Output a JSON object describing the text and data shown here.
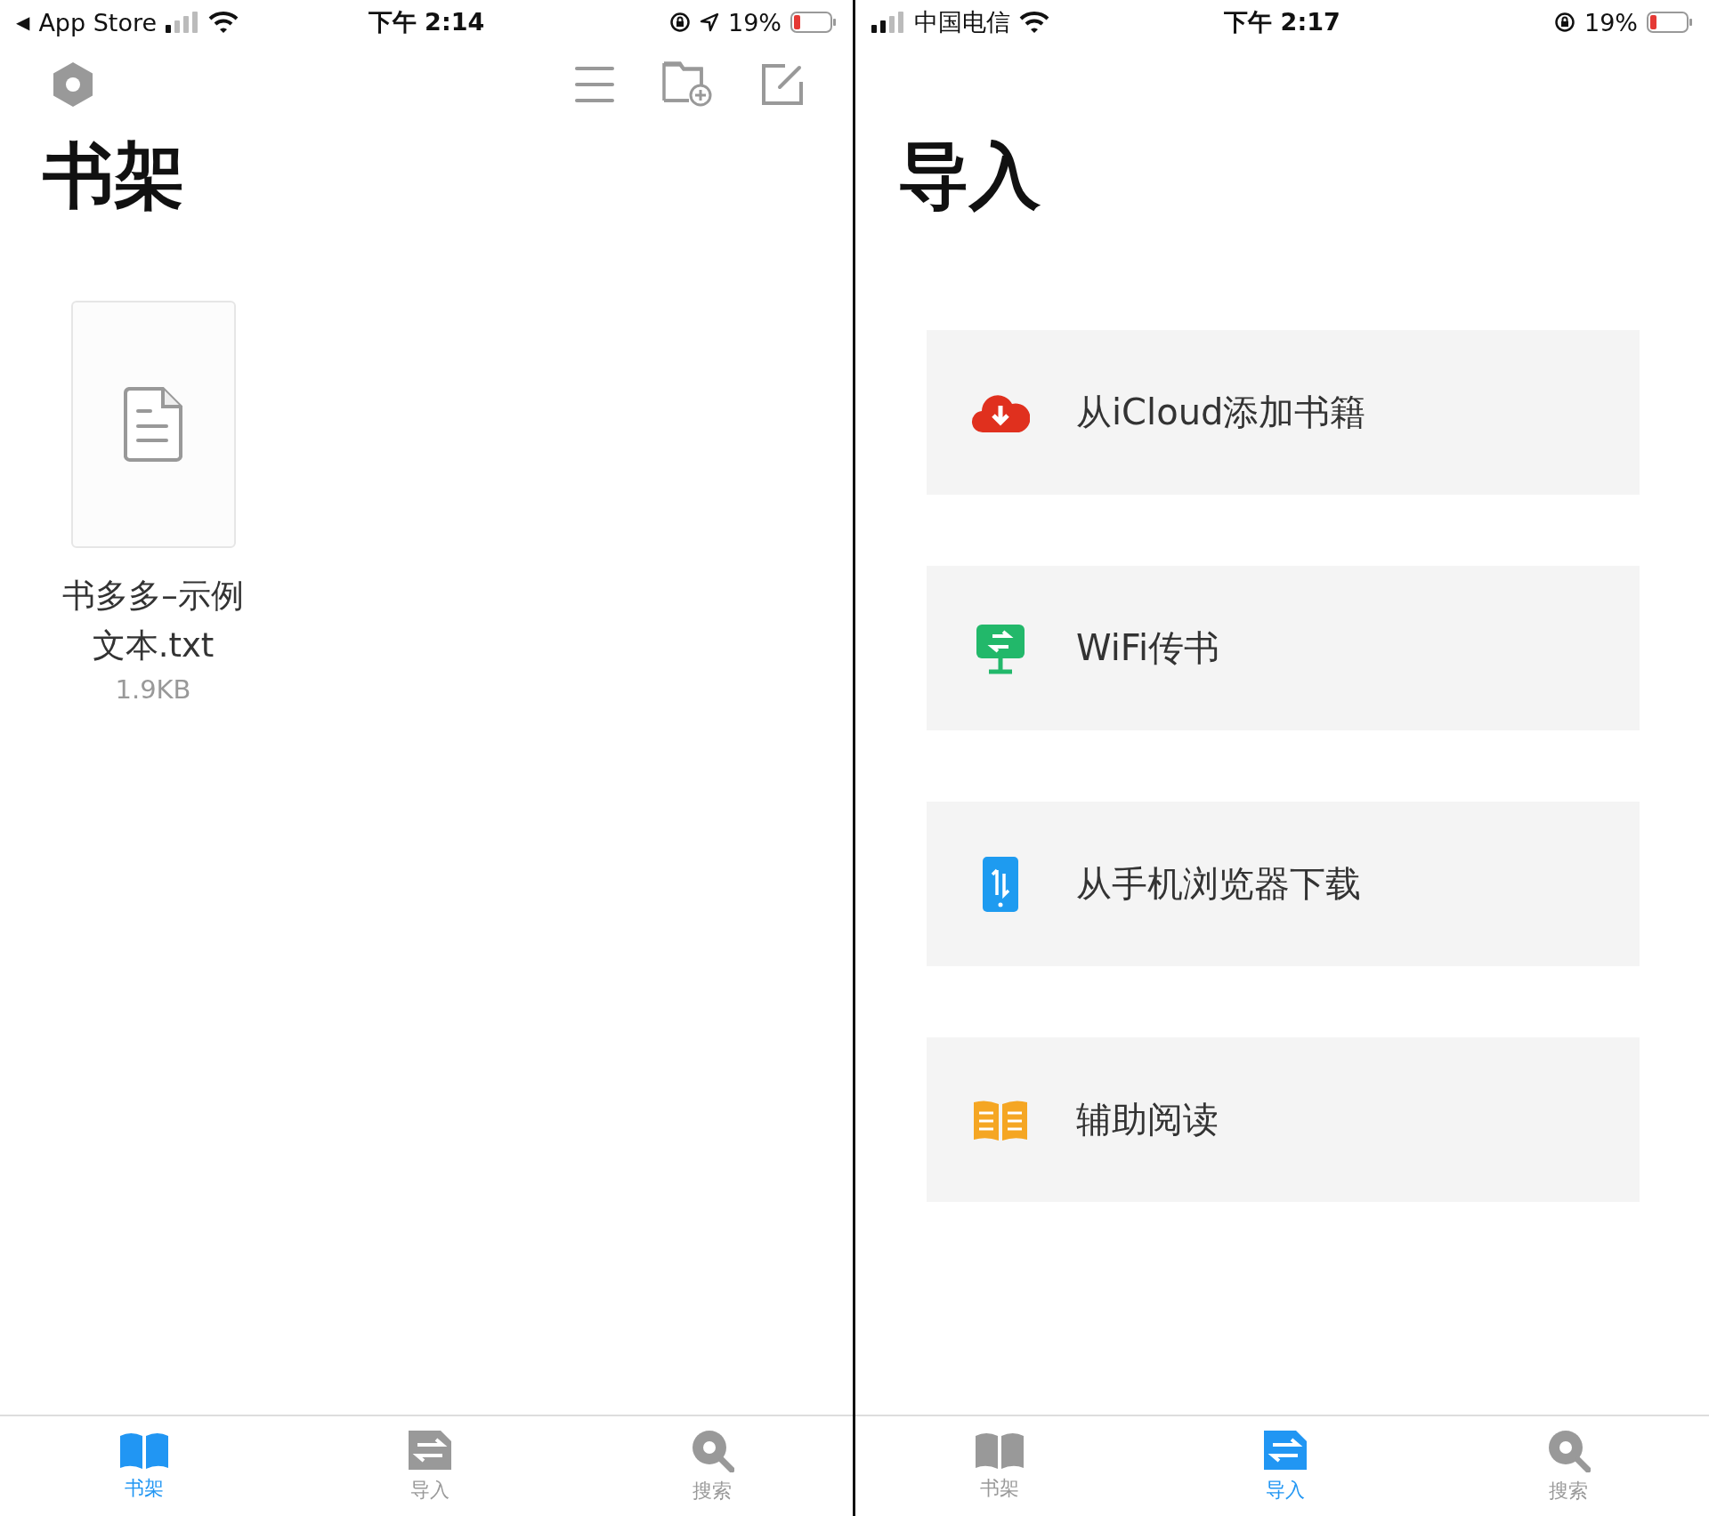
{
  "screens": [
    {
      "kind": "shelf",
      "status_bar": {
        "back_arrow": "◀",
        "carrier": "App Store",
        "time": "下午 2:14",
        "location": true,
        "battery": "19%"
      },
      "title": "书架",
      "books": [
        {
          "name": "书多多–示例文本.txt",
          "size": "1.9KB"
        }
      ],
      "tabs": [
        {
          "label": "书架",
          "kind": "book",
          "selected": true
        },
        {
          "label": "导入",
          "kind": "import",
          "selected": false
        },
        {
          "label": "搜索",
          "kind": "search",
          "selected": false
        }
      ]
    },
    {
      "kind": "import",
      "status_bar": {
        "carrier": "中国电信",
        "time": "下午 2:17",
        "location": false,
        "battery": "19%"
      },
      "title": "导入",
      "items": [
        {
          "kind": "cloud",
          "label": "从iCloud添加书籍"
        },
        {
          "kind": "wifi",
          "label": "WiFi传书"
        },
        {
          "kind": "phone",
          "label": "从手机浏览器下载"
        },
        {
          "kind": "book",
          "label": "辅助阅读"
        }
      ],
      "tabs": [
        {
          "label": "书架",
          "kind": "book",
          "selected": false
        },
        {
          "label": "导入",
          "kind": "import",
          "selected": true
        },
        {
          "label": "搜索",
          "kind": "search",
          "selected": false
        }
      ]
    }
  ]
}
